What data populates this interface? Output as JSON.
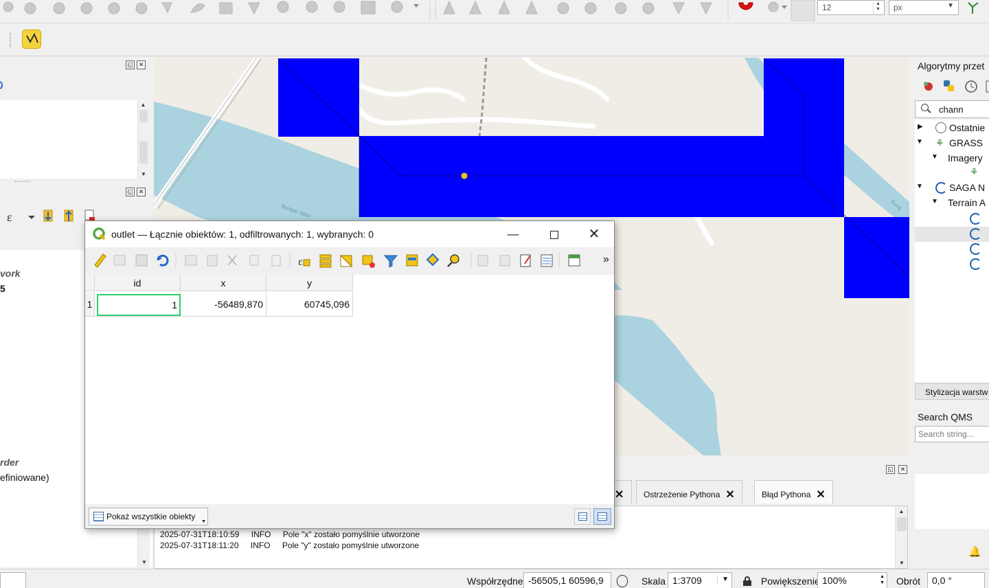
{
  "toolbar": {
    "font_size_value": "12",
    "unit_value": "px"
  },
  "left_panel": {
    "text_work": "vork",
    "text_five": "5",
    "text_order": "rder",
    "text_undefined": "efiniowane)"
  },
  "right_panel": {
    "title": "Algorytmy przet",
    "search_value": "chann",
    "tree": {
      "recent": "Ostatnie",
      "grass": "GRASS",
      "imagery": "Imagery",
      "saga": "SAGA N",
      "terrain": "Terrain A"
    },
    "styling_tab": "Stylizacja warstw",
    "qms_title": "Search QMS",
    "qms_placeholder": "Search string..."
  },
  "map": {
    "river_label_1": "Sungai Jabir",
    "river_label_2": "Sung"
  },
  "dialog": {
    "title": "outlet — Łącznie obiektów: 1, odfiltrowanych: 1, wybranych: 0",
    "more": "»",
    "columns": [
      "id",
      "x",
      "y"
    ],
    "rows": [
      {
        "num": "1",
        "id": "1",
        "x": "-56489,870",
        "y": "60745,096"
      }
    ],
    "show_all_label": "Pokaż wszystkie obiekty"
  },
  "log_panel": {
    "tabs": [
      "Ostrzeżenie Pythona",
      "Błąd Pythona"
    ],
    "lines": [
      {
        "time": "2025-07-31T18:10:59",
        "level": "INFO",
        "msg": "Pole \"x\" zostało pomyślnie utworzone"
      },
      {
        "time": "2025-07-31T18:11:20",
        "level": "INFO",
        "msg": "Pole \"y\" zostało pomyślnie utworzone"
      }
    ]
  },
  "status_bar": {
    "coords_label": "Współrzędne",
    "coords_value": "-56505,1  60596,9",
    "scale_label": "Skala",
    "scale_value": "1:3709",
    "zoom_label": "Powiększenie",
    "zoom_value": "100%",
    "rotation_label": "Obrót",
    "rotation_value": "0,0 °"
  },
  "colors": {
    "polygon_fill": "#0000ff",
    "water": "#aad3df",
    "map_bg": "#f0ede6",
    "outlet_point": "#e6c229",
    "selected_cell_border": "#2ecc71"
  }
}
